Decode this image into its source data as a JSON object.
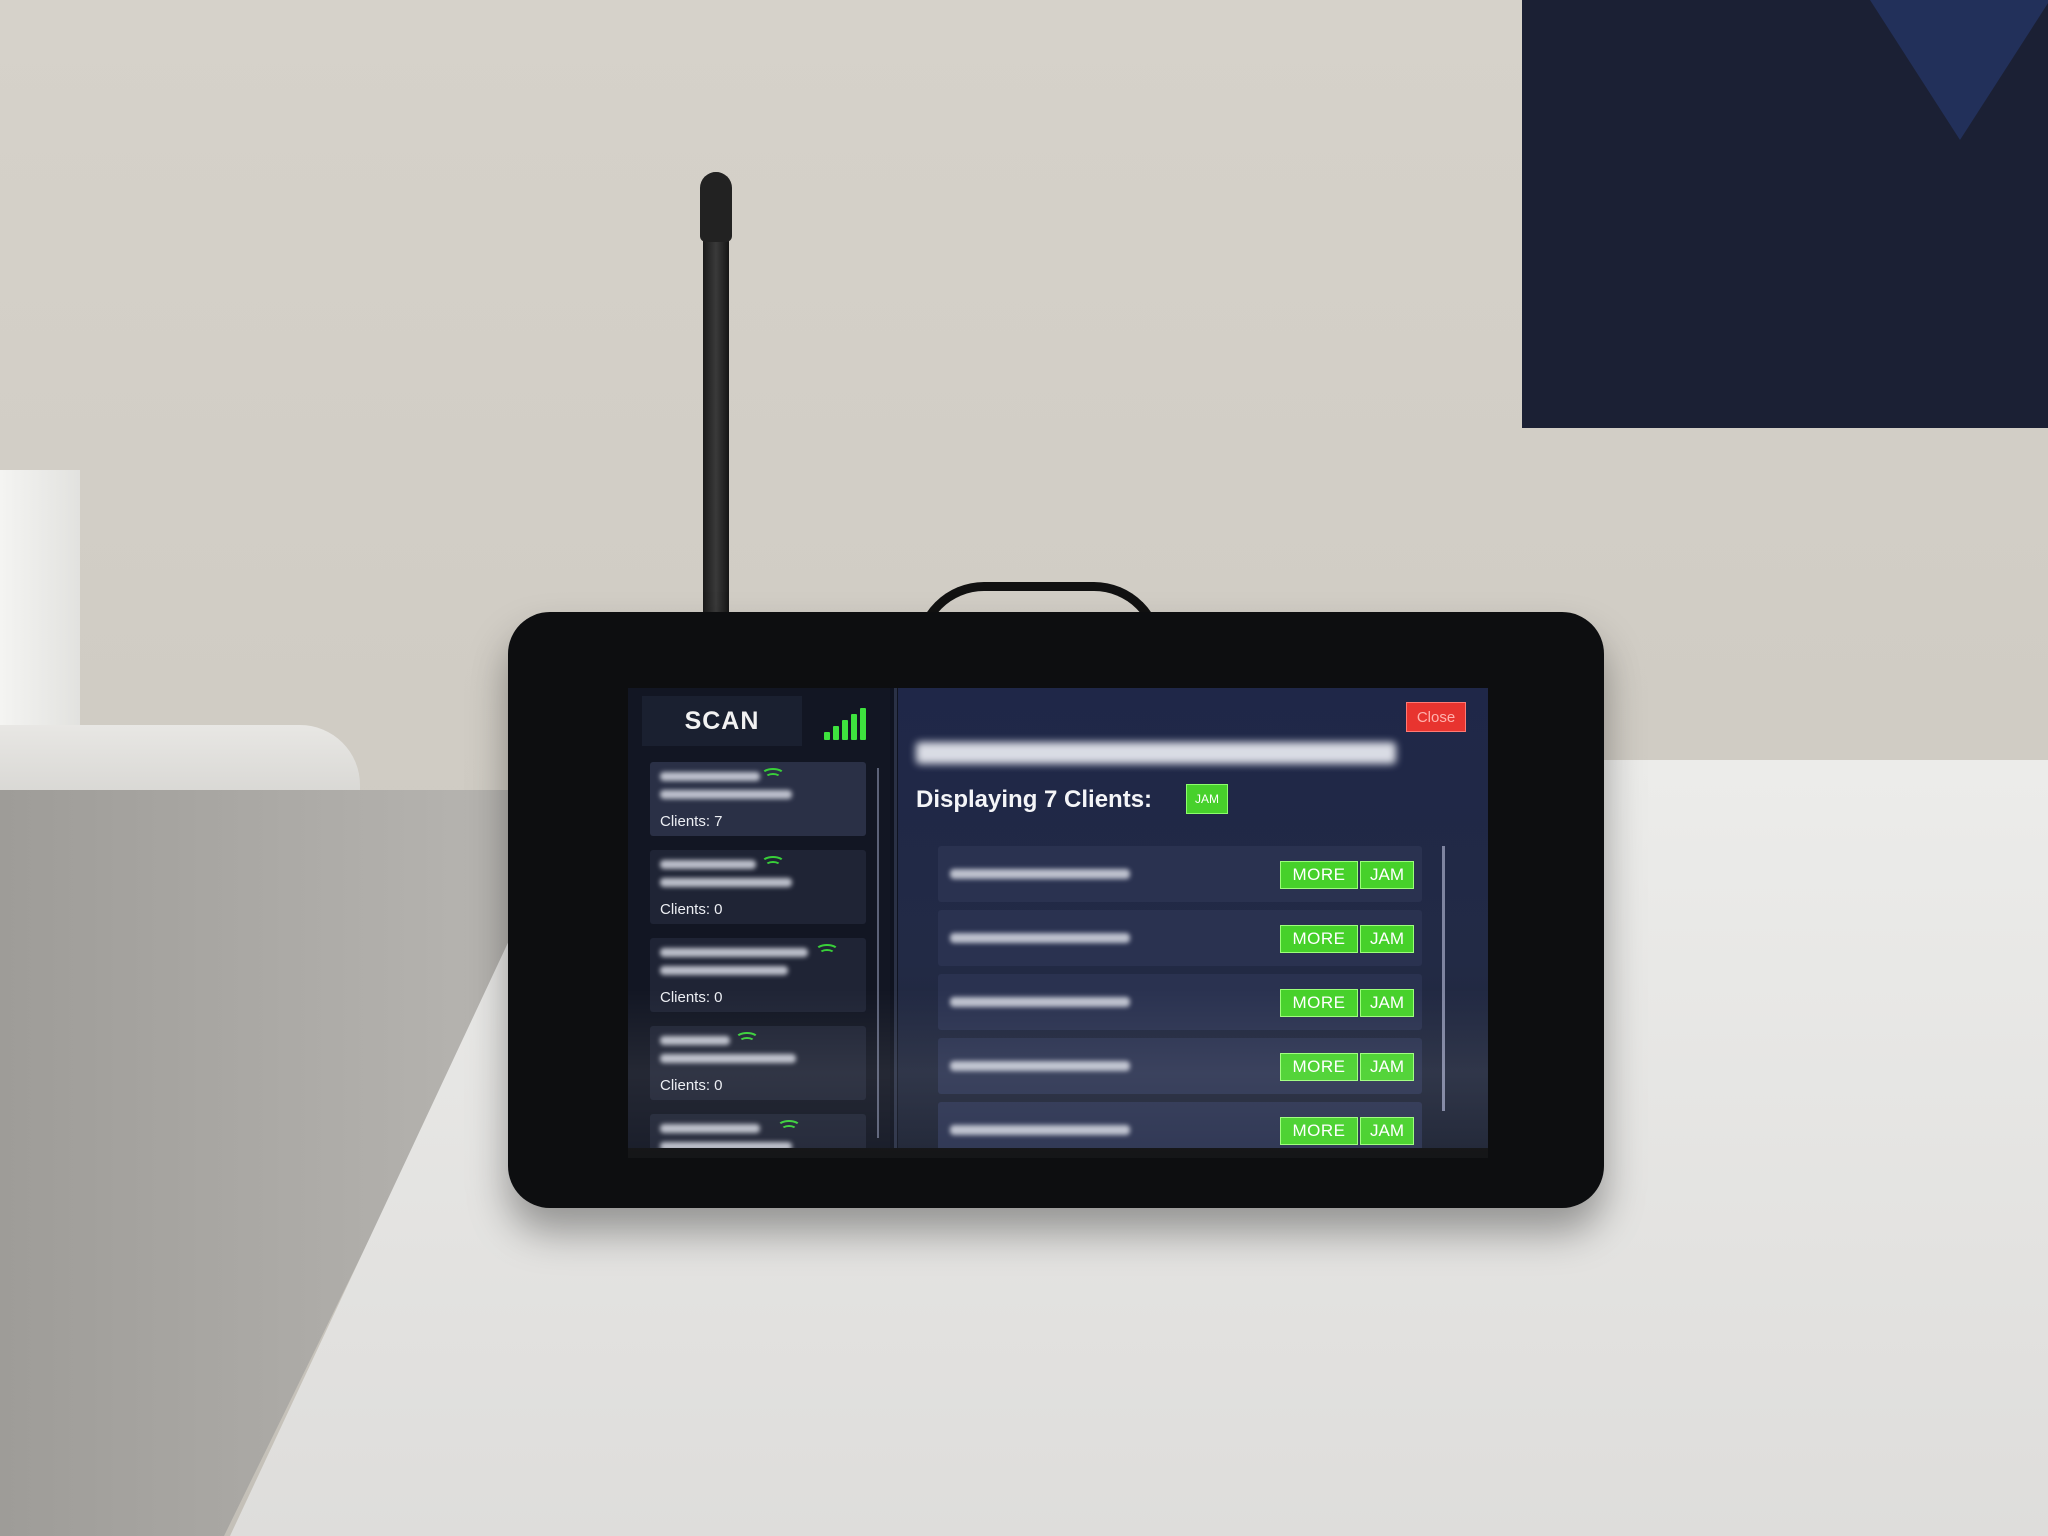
{
  "scan_label": "SCAN",
  "close_label": "Close",
  "displaying_label": "Displaying 7 Clients:",
  "jam_all_label": "JAM",
  "networks": [
    {
      "clients_label": "Clients: 7",
      "selected": true
    },
    {
      "clients_label": "Clients: 0",
      "selected": false
    },
    {
      "clients_label": "Clients: 0",
      "selected": false
    },
    {
      "clients_label": "Clients: 0",
      "selected": false
    },
    {
      "clients_label": "",
      "selected": false
    }
  ],
  "clients": [
    {
      "more_label": "MORE",
      "jam_label": "JAM"
    },
    {
      "more_label": "MORE",
      "jam_label": "JAM"
    },
    {
      "more_label": "MORE",
      "jam_label": "JAM"
    },
    {
      "more_label": "MORE",
      "jam_label": "JAM"
    },
    {
      "more_label": "MORE",
      "jam_label": "JAM"
    }
  ],
  "colors": {
    "accent_green": "#46d12a",
    "close_red": "#e8342f",
    "signal_green": "#3ee23e"
  }
}
